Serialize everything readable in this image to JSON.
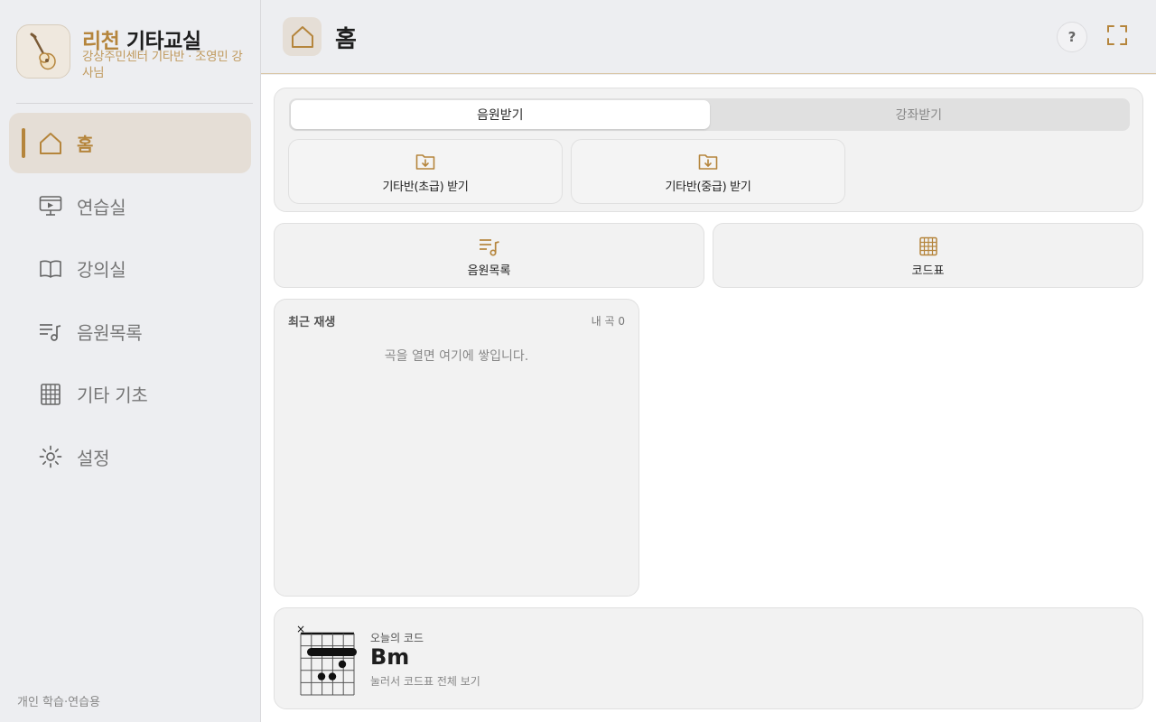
{
  "brand": {
    "title_accent": "리천",
    "title_main": " 기타교실",
    "subtitle": "강상주민센터 기타반 · 조영민 강사님"
  },
  "sidebar": {
    "items": [
      {
        "label": "홈",
        "icon": "home-icon",
        "active": true
      },
      {
        "label": "연습실",
        "icon": "practice-screen-icon",
        "active": false
      },
      {
        "label": "강의실",
        "icon": "book-icon",
        "active": false
      },
      {
        "label": "음원목록",
        "icon": "music-list-icon",
        "active": false
      },
      {
        "label": "기타 기초",
        "icon": "grid-icon",
        "active": false
      },
      {
        "label": "설정",
        "icon": "gear-icon",
        "active": false
      }
    ],
    "footer": "개인 학습·연습용"
  },
  "header": {
    "title": "홈",
    "help_label": "?"
  },
  "downloads": {
    "tabs": [
      {
        "label": "음원받기",
        "active": true
      },
      {
        "label": "강좌받기",
        "active": false
      }
    ],
    "buttons": [
      {
        "label": "기타반(초급) 받기",
        "icon": "folder-download-icon"
      },
      {
        "label": "기타반(중급) 받기",
        "icon": "folder-download-icon"
      }
    ]
  },
  "quick_links": [
    {
      "label": "음원목록",
      "icon": "music-list-icon"
    },
    {
      "label": "코드표",
      "icon": "grid-icon"
    }
  ],
  "recent": {
    "title": "최근 재생",
    "count_label": "내 곡 0",
    "empty_message": "곡을 열면 여기에 쌓입니다."
  },
  "chord_of_day": {
    "caption": "오늘의 코드",
    "name": "Bm",
    "hint": "눌러서 코드표 전체 보기",
    "mute_mark": "×"
  },
  "colors": {
    "accent": "#b5853c",
    "active_bg": "#e5ded6",
    "sidebar_bg": "#edeef1"
  }
}
